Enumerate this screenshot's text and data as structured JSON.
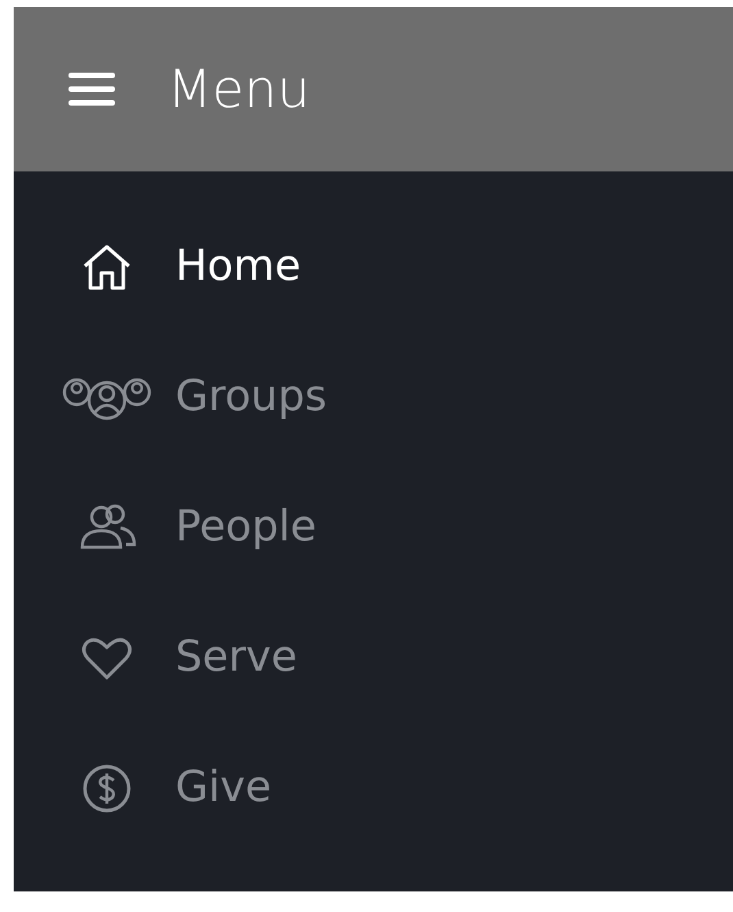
{
  "header": {
    "title": "Menu"
  },
  "items": [
    {
      "label": "Home",
      "selected": true
    },
    {
      "label": "Groups",
      "selected": false
    },
    {
      "label": "People",
      "selected": false
    },
    {
      "label": "Serve",
      "selected": false
    },
    {
      "label": "Give",
      "selected": false
    }
  ]
}
